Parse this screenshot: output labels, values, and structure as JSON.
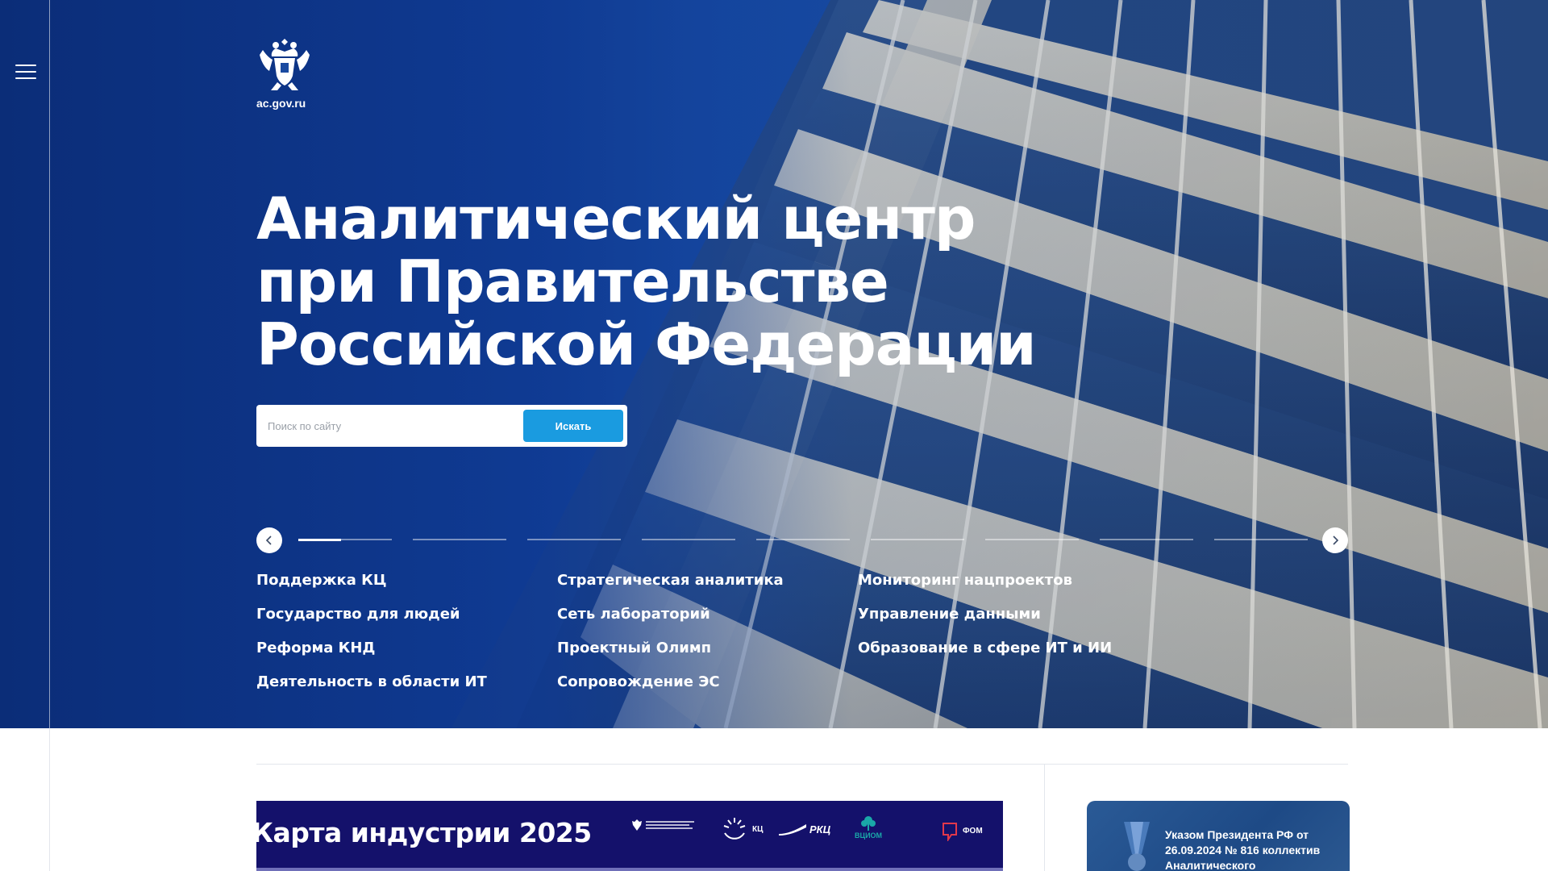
{
  "site": {
    "domain": "ac.gov.ru",
    "title_lines": [
      "Аналитический центр",
      "при Правительстве",
      "Российской Федерации"
    ]
  },
  "search": {
    "placeholder": "Поиск по сайту",
    "button_label": "Искать"
  },
  "slider": {
    "active_index": 0,
    "active_progress": 0.46,
    "dot_count": 9,
    "prev_icon": "chevron-left-icon",
    "next_icon": "chevron-right-icon"
  },
  "links": [
    "Поддержка КЦ",
    "Стратегическая аналитика",
    "Мониторинг нацпроектов",
    "Государство для людей",
    "Сеть лабораторий",
    "Управление данными",
    "Реформа КНД",
    "Проектный Олимп",
    "Образование в сфере ИТ и ИИ",
    "Деятельность в области ИТ",
    "Сопровождение ЭС"
  ],
  "banner": {
    "title": "Карта индустрии 2025",
    "partners": [
      "КЦ",
      "РКЦ",
      "ВЦИОМ",
      "ФОМ"
    ]
  },
  "decree": {
    "text": "Указом Президента РФ от 26.09.2024 № 816 коллектив Аналитического"
  },
  "colors": {
    "accent": "#1a9be0",
    "hero_blue": "#103a91",
    "banner_navy": "#14116b"
  }
}
